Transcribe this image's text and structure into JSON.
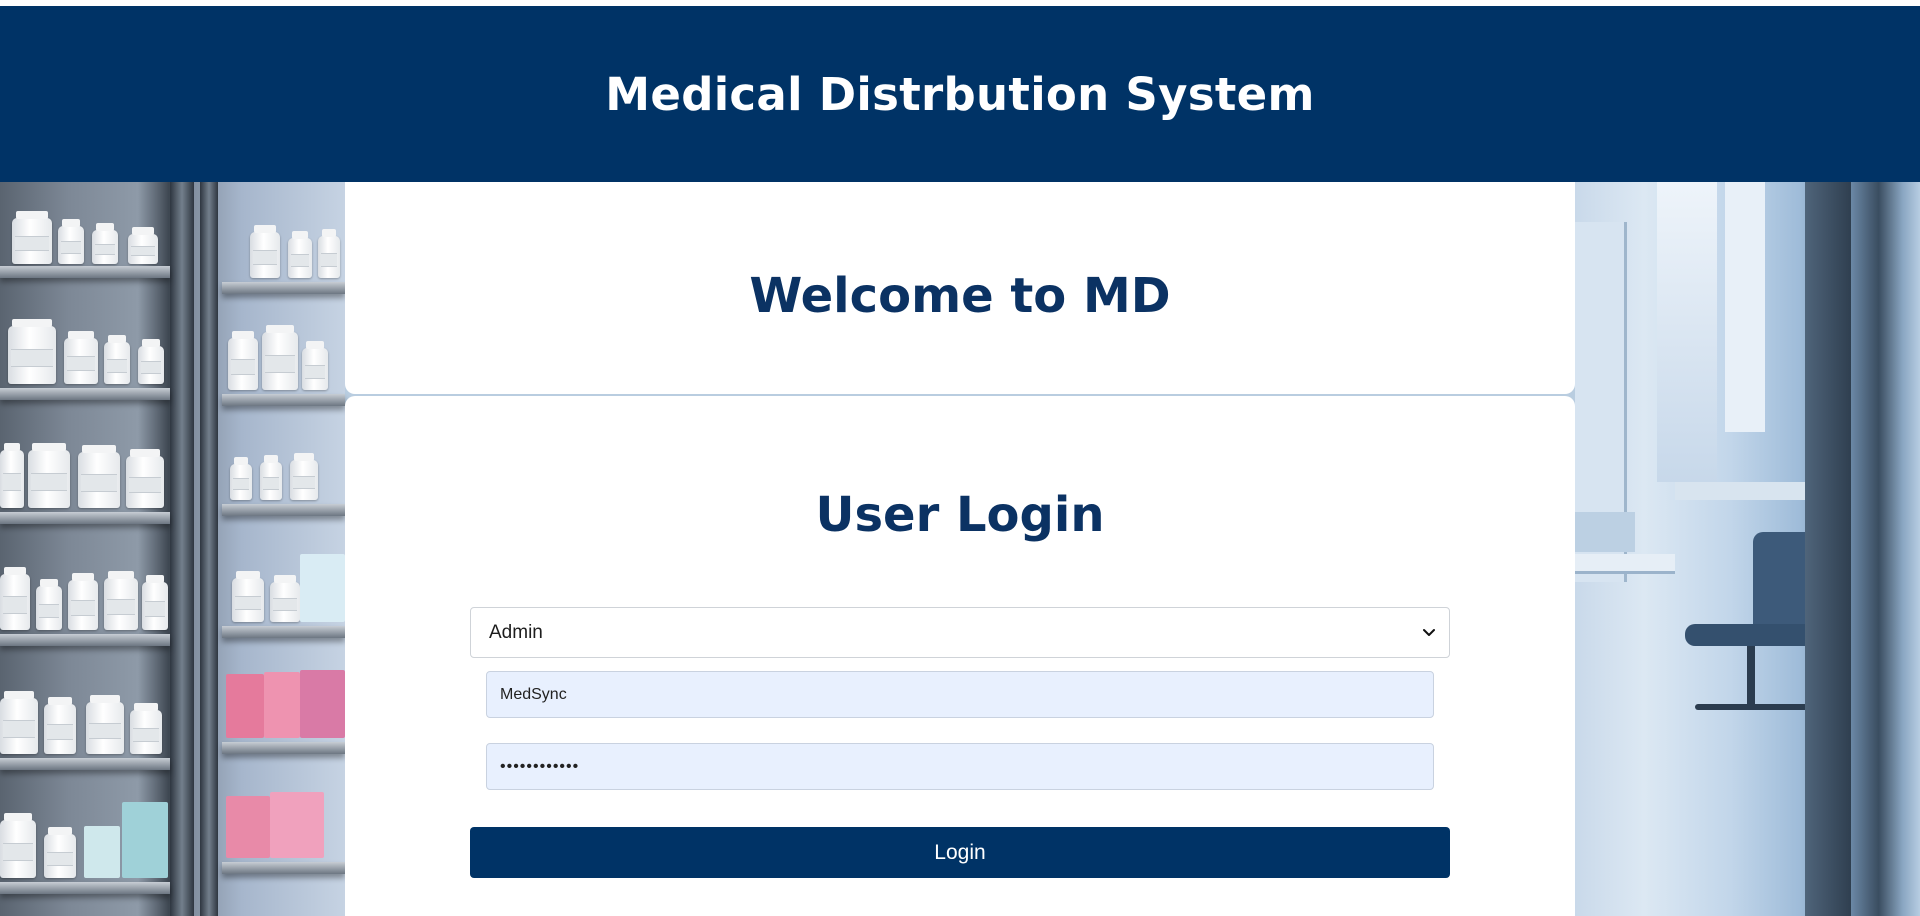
{
  "header": {
    "title": "Medical Distrbution System"
  },
  "welcome": {
    "title": "Welcome to MD"
  },
  "login": {
    "title": "User Login",
    "role_select": {
      "selected": "Admin"
    },
    "username": {
      "value": "MedSync"
    },
    "password": {
      "masked_value": "••••••••••••"
    },
    "submit_label": "Login"
  },
  "colors": {
    "brand_navy": "#003366",
    "heading_navy": "#0b3263",
    "autofill_field": "#e8f0fe",
    "card_background": "#ffffff"
  },
  "icons": {
    "select_indicator": "chevron-down-icon"
  }
}
